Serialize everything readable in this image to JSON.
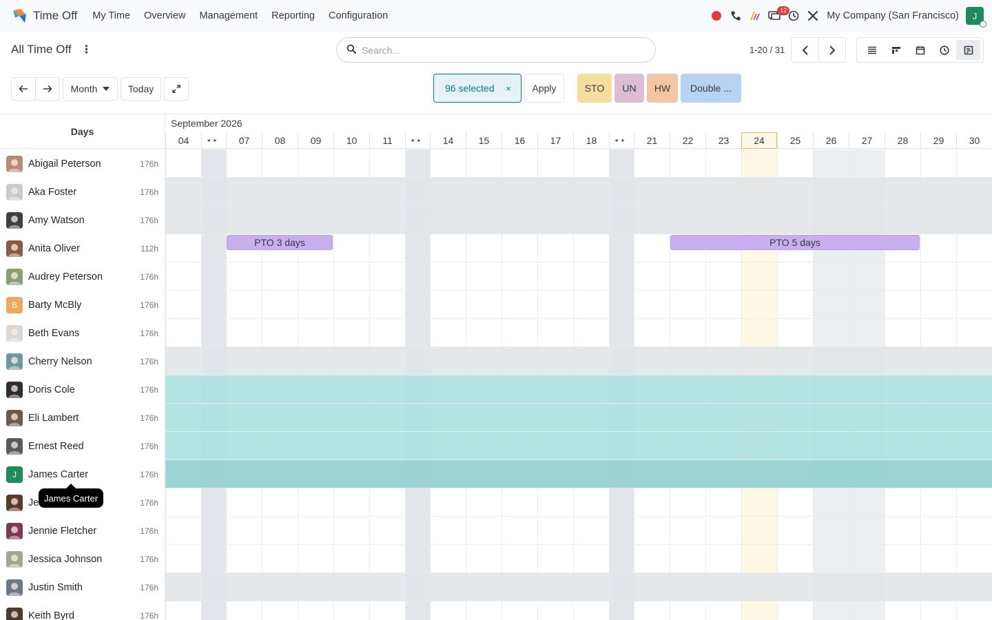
{
  "app": {
    "name": "Time Off"
  },
  "menu": [
    "My Time",
    "Overview",
    "Management",
    "Reporting",
    "Configuration"
  ],
  "systray": {
    "company": "My Company (San Francisco)",
    "messages_badge": "12",
    "user_initial": "J"
  },
  "control_panel": {
    "title": "All Time Off",
    "search_placeholder": "Search...",
    "pager_value": "1-20 / 31"
  },
  "toolbar": {
    "scale": "Month",
    "today": "Today",
    "selected": "96 selected",
    "selected_remove": "×",
    "apply": "Apply",
    "legend": [
      {
        "label": "STO",
        "color": "#f6dea0"
      },
      {
        "label": "UN",
        "color": "#dcbed4"
      },
      {
        "label": "HW",
        "color": "#f4c6a4"
      },
      {
        "label": "Double ...",
        "color": "#b6d3f2"
      }
    ]
  },
  "gantt": {
    "rows_header": "Days",
    "month": "September 2026",
    "today_day": "24",
    "days": [
      "04",
      "",
      "07",
      "08",
      "09",
      "10",
      "11",
      "",
      "14",
      "15",
      "16",
      "17",
      "18",
      "",
      "21",
      "22",
      "23",
      "24",
      "25",
      "26",
      "27",
      "28",
      "29",
      "30"
    ],
    "employees": [
      {
        "name": "Abigail Peterson",
        "hours": "176h",
        "avatar_color": "#b98a7a",
        "state": "normal"
      },
      {
        "name": "Aka Foster",
        "hours": "176h",
        "avatar_color": "#c8ccd0",
        "state": "gray"
      },
      {
        "name": "Amy Watson",
        "hours": "176h",
        "avatar_color": "#3b4148",
        "state": "gray"
      },
      {
        "name": "Anita Oliver",
        "hours": "112h",
        "avatar_color": "#8a5a44",
        "state": "normal"
      },
      {
        "name": "Audrey Peterson",
        "hours": "176h",
        "avatar_color": "#8b9e7a",
        "state": "normal"
      },
      {
        "name": "Barty McBly",
        "hours": "176h",
        "avatar_color": "#f0a860",
        "avatar_initial": "B",
        "state": "normal"
      },
      {
        "name": "Beth Evans",
        "hours": "176h",
        "avatar_color": "#d8d8d8",
        "state": "normal"
      },
      {
        "name": "Cherry Nelson",
        "hours": "176h",
        "avatar_color": "#6a9aa0",
        "state": "gray"
      },
      {
        "name": "Doris Cole",
        "hours": "176h",
        "avatar_color": "#2e2e2e",
        "state": "teal"
      },
      {
        "name": "Eli Lambert",
        "hours": "176h",
        "avatar_color": "#6b5a50",
        "state": "teal"
      },
      {
        "name": "Ernest Reed",
        "hours": "176h",
        "avatar_color": "#5a5a5a",
        "state": "teal"
      },
      {
        "name": "James Carter",
        "hours": "176h",
        "avatar_color": "#1f8a5c",
        "avatar_initial": "J",
        "state": "teal-dark"
      },
      {
        "name": "Je",
        "hours": "176h",
        "avatar_color": "#5a3a2a",
        "state": "normal"
      },
      {
        "name": "Jennie Fletcher",
        "hours": "176h",
        "avatar_color": "#7a3a5a",
        "state": "normal"
      },
      {
        "name": "Jessica Johnson",
        "hours": "176h",
        "avatar_color": "#a0a890",
        "state": "normal"
      },
      {
        "name": "Justin Smith",
        "hours": "176h",
        "avatar_color": "#6a7a8a",
        "state": "gray"
      },
      {
        "name": "Keith Byrd",
        "hours": "176h",
        "avatar_color": "#4a3a30",
        "state": "normal"
      }
    ],
    "pills": [
      {
        "row": 3,
        "label": "PTO 3 days",
        "start_day": "07",
        "end_day": "09"
      },
      {
        "row": 3,
        "label": "PTO 5 days",
        "start_day": "22",
        "end_day": "28"
      }
    ],
    "tooltip": "James Carter"
  }
}
